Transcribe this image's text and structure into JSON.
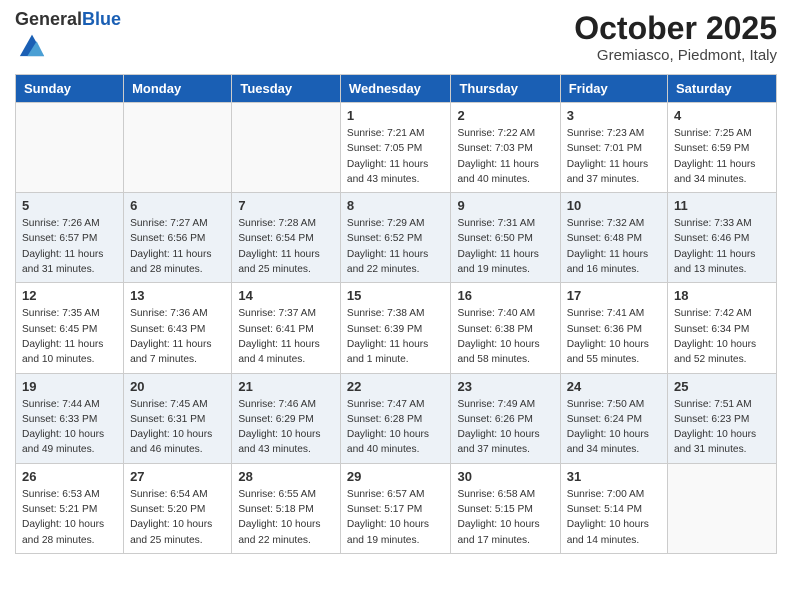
{
  "header": {
    "logo_general": "General",
    "logo_blue": "Blue",
    "month_title": "October 2025",
    "location": "Gremiasco, Piedmont, Italy"
  },
  "days_of_week": [
    "Sunday",
    "Monday",
    "Tuesday",
    "Wednesday",
    "Thursday",
    "Friday",
    "Saturday"
  ],
  "weeks": [
    [
      {
        "day": "",
        "info": ""
      },
      {
        "day": "",
        "info": ""
      },
      {
        "day": "",
        "info": ""
      },
      {
        "day": "1",
        "info": "Sunrise: 7:21 AM\nSunset: 7:05 PM\nDaylight: 11 hours\nand 43 minutes."
      },
      {
        "day": "2",
        "info": "Sunrise: 7:22 AM\nSunset: 7:03 PM\nDaylight: 11 hours\nand 40 minutes."
      },
      {
        "day": "3",
        "info": "Sunrise: 7:23 AM\nSunset: 7:01 PM\nDaylight: 11 hours\nand 37 minutes."
      },
      {
        "day": "4",
        "info": "Sunrise: 7:25 AM\nSunset: 6:59 PM\nDaylight: 11 hours\nand 34 minutes."
      }
    ],
    [
      {
        "day": "5",
        "info": "Sunrise: 7:26 AM\nSunset: 6:57 PM\nDaylight: 11 hours\nand 31 minutes."
      },
      {
        "day": "6",
        "info": "Sunrise: 7:27 AM\nSunset: 6:56 PM\nDaylight: 11 hours\nand 28 minutes."
      },
      {
        "day": "7",
        "info": "Sunrise: 7:28 AM\nSunset: 6:54 PM\nDaylight: 11 hours\nand 25 minutes."
      },
      {
        "day": "8",
        "info": "Sunrise: 7:29 AM\nSunset: 6:52 PM\nDaylight: 11 hours\nand 22 minutes."
      },
      {
        "day": "9",
        "info": "Sunrise: 7:31 AM\nSunset: 6:50 PM\nDaylight: 11 hours\nand 19 minutes."
      },
      {
        "day": "10",
        "info": "Sunrise: 7:32 AM\nSunset: 6:48 PM\nDaylight: 11 hours\nand 16 minutes."
      },
      {
        "day": "11",
        "info": "Sunrise: 7:33 AM\nSunset: 6:46 PM\nDaylight: 11 hours\nand 13 minutes."
      }
    ],
    [
      {
        "day": "12",
        "info": "Sunrise: 7:35 AM\nSunset: 6:45 PM\nDaylight: 11 hours\nand 10 minutes."
      },
      {
        "day": "13",
        "info": "Sunrise: 7:36 AM\nSunset: 6:43 PM\nDaylight: 11 hours\nand 7 minutes."
      },
      {
        "day": "14",
        "info": "Sunrise: 7:37 AM\nSunset: 6:41 PM\nDaylight: 11 hours\nand 4 minutes."
      },
      {
        "day": "15",
        "info": "Sunrise: 7:38 AM\nSunset: 6:39 PM\nDaylight: 11 hours\nand 1 minute."
      },
      {
        "day": "16",
        "info": "Sunrise: 7:40 AM\nSunset: 6:38 PM\nDaylight: 10 hours\nand 58 minutes."
      },
      {
        "day": "17",
        "info": "Sunrise: 7:41 AM\nSunset: 6:36 PM\nDaylight: 10 hours\nand 55 minutes."
      },
      {
        "day": "18",
        "info": "Sunrise: 7:42 AM\nSunset: 6:34 PM\nDaylight: 10 hours\nand 52 minutes."
      }
    ],
    [
      {
        "day": "19",
        "info": "Sunrise: 7:44 AM\nSunset: 6:33 PM\nDaylight: 10 hours\nand 49 minutes."
      },
      {
        "day": "20",
        "info": "Sunrise: 7:45 AM\nSunset: 6:31 PM\nDaylight: 10 hours\nand 46 minutes."
      },
      {
        "day": "21",
        "info": "Sunrise: 7:46 AM\nSunset: 6:29 PM\nDaylight: 10 hours\nand 43 minutes."
      },
      {
        "day": "22",
        "info": "Sunrise: 7:47 AM\nSunset: 6:28 PM\nDaylight: 10 hours\nand 40 minutes."
      },
      {
        "day": "23",
        "info": "Sunrise: 7:49 AM\nSunset: 6:26 PM\nDaylight: 10 hours\nand 37 minutes."
      },
      {
        "day": "24",
        "info": "Sunrise: 7:50 AM\nSunset: 6:24 PM\nDaylight: 10 hours\nand 34 minutes."
      },
      {
        "day": "25",
        "info": "Sunrise: 7:51 AM\nSunset: 6:23 PM\nDaylight: 10 hours\nand 31 minutes."
      }
    ],
    [
      {
        "day": "26",
        "info": "Sunrise: 6:53 AM\nSunset: 5:21 PM\nDaylight: 10 hours\nand 28 minutes."
      },
      {
        "day": "27",
        "info": "Sunrise: 6:54 AM\nSunset: 5:20 PM\nDaylight: 10 hours\nand 25 minutes."
      },
      {
        "day": "28",
        "info": "Sunrise: 6:55 AM\nSunset: 5:18 PM\nDaylight: 10 hours\nand 22 minutes."
      },
      {
        "day": "29",
        "info": "Sunrise: 6:57 AM\nSunset: 5:17 PM\nDaylight: 10 hours\nand 19 minutes."
      },
      {
        "day": "30",
        "info": "Sunrise: 6:58 AM\nSunset: 5:15 PM\nDaylight: 10 hours\nand 17 minutes."
      },
      {
        "day": "31",
        "info": "Sunrise: 7:00 AM\nSunset: 5:14 PM\nDaylight: 10 hours\nand 14 minutes."
      },
      {
        "day": "",
        "info": ""
      }
    ]
  ]
}
